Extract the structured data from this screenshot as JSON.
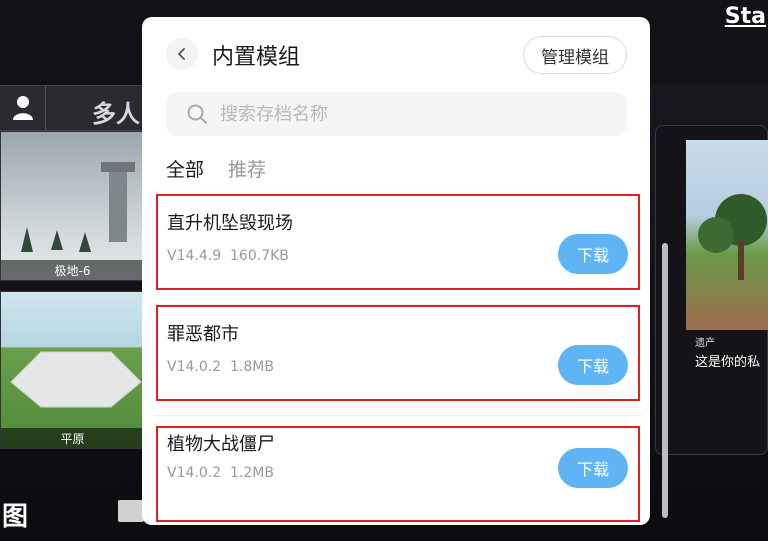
{
  "background": {
    "start_label": "Sta",
    "multiplayer_label": "多人",
    "maps": [
      {
        "label": "极地-6"
      },
      {
        "label": "平原"
      }
    ],
    "right_card": {
      "small_label": "遗产",
      "description": "这是你的私"
    },
    "bottom_char": "图"
  },
  "modal": {
    "title": "内置模组",
    "manage_label": "管理模组",
    "search": {
      "placeholder": "搜索存档名称",
      "value": ""
    },
    "tabs": [
      {
        "label": "全部",
        "active": true
      },
      {
        "label": "推荐",
        "active": false
      }
    ],
    "items": [
      {
        "name": "直升机坠毁现场",
        "version": "V14.4.9",
        "size": "160.7KB",
        "button": "下载"
      },
      {
        "name": "罪恶都市",
        "version": "V14.0.2",
        "size": "1.8MB",
        "button": "下载"
      },
      {
        "name": "植物大战僵尸",
        "version": "V14.0.2",
        "size": "1.2MB",
        "button": "下载"
      }
    ]
  },
  "colors": {
    "download_button": "#5fb4f4",
    "highlight_border": "#e0201f"
  }
}
